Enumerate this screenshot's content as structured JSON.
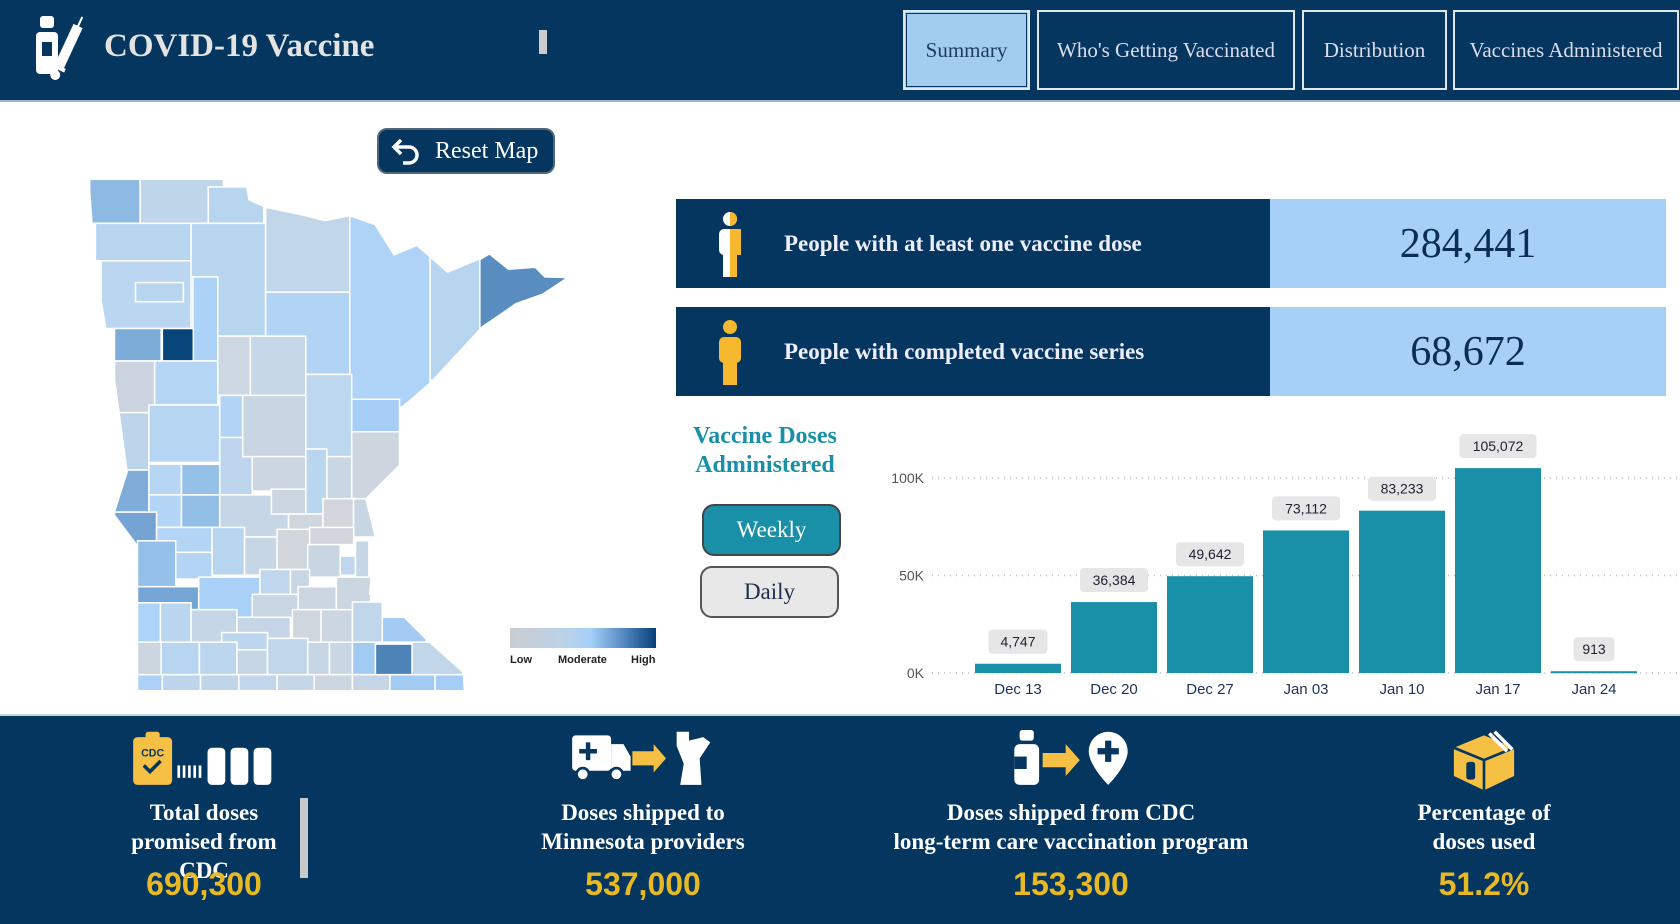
{
  "header": {
    "title": "COVID-19 Vaccine",
    "logo_icon": "vaccine-vial-syringe-icon",
    "tabs": [
      {
        "label": "Summary",
        "active": true
      },
      {
        "label": "Who's Getting Vaccinated"
      },
      {
        "label": "Distribution"
      },
      {
        "label": "Vaccines Administered"
      }
    ]
  },
  "map": {
    "reset_label": "Reset Map",
    "legend": {
      "low": "Low",
      "moderate": "Moderate",
      "high": "High"
    },
    "colors": {
      "low": "#c9ccd0",
      "moderate": "#a6d0f8",
      "high": "#063f78"
    }
  },
  "kpis": [
    {
      "label": "People with at least one vaccine dose",
      "value": "284,441",
      "icon": "person-half-icon"
    },
    {
      "label": "People with completed vaccine series",
      "value": "68,672",
      "icon": "person-full-icon"
    }
  ],
  "doses": {
    "title_line1": "Vaccine Doses",
    "title_line2": "Administered",
    "weekly_label": "Weekly",
    "daily_label": "Daily"
  },
  "chart_data": {
    "type": "bar",
    "categories": [
      "Dec 13",
      "Dec 20",
      "Dec 27",
      "Jan 03",
      "Jan 10",
      "Jan 17",
      "Jan 24"
    ],
    "values": [
      4747,
      36384,
      49642,
      73112,
      83233,
      105072,
      913
    ],
    "labels": [
      "4,747",
      "36,384",
      "49,642",
      "73,112",
      "83,233",
      "105,072",
      "913"
    ],
    "yticks": [
      {
        "v": 0,
        "label": "0K"
      },
      {
        "v": 50000,
        "label": "50K"
      },
      {
        "v": 100000,
        "label": "100K"
      }
    ],
    "ylim": [
      0,
      105072
    ],
    "grid": true,
    "color": "#1a8fa8"
  },
  "footer": [
    {
      "label": [
        "Total doses",
        "promised from",
        "CDC"
      ],
      "value": "690,300",
      "icon": "cdc-clipboard-vials-icon"
    },
    {
      "label": [
        "Doses shipped to",
        "Minnesota providers"
      ],
      "value": "537,000",
      "icon": "truck-to-minnesota-icon"
    },
    {
      "label": [
        "Doses shipped from CDC",
        "long-term care vaccination program"
      ],
      "value": "153,300",
      "icon": "vial-to-clinic-icon"
    },
    {
      "label": [
        "Percentage of",
        "doses used"
      ],
      "value": "51.2%",
      "icon": "vaccine-box-icon"
    }
  ],
  "colors": {
    "navy": "#04365f",
    "teal": "#1a8fa8",
    "gold": "#e8b923",
    "light_blue": "#a6d0f8"
  }
}
